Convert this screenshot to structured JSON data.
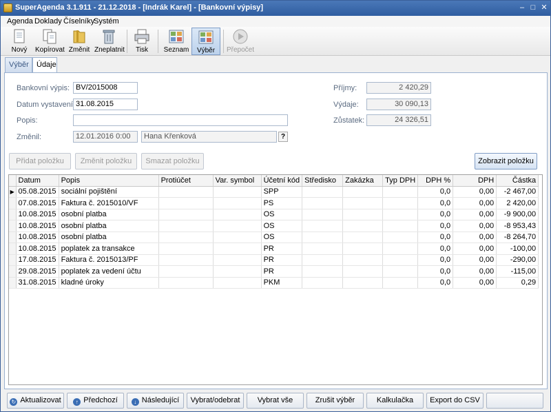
{
  "window": {
    "title": "SuperAgenda 3.1.911 - 21.12.2018 - [Indrák Karel] - [Bankovní výpisy]"
  },
  "menu": [
    "Agenda",
    "Doklady",
    "Číselníky",
    "Systém"
  ],
  "toolbar": {
    "new": "Nový",
    "copy": "Kopírovat",
    "edit": "Změnit",
    "invalidate": "Zneplatnit",
    "print": "Tisk",
    "list": "Seznam",
    "select": "Výběr",
    "recalc": "Přepočet"
  },
  "tabs": [
    "Výběr",
    "Údaje"
  ],
  "form": {
    "statement_label": "Bankovní výpis:",
    "statement_value": "BV/2015008",
    "date_label": "Datum vystavení:",
    "date_value": "31.08.2015",
    "desc_label": "Popis:",
    "desc_value": "",
    "changed_label": "Změnil:",
    "changed_date": "12.01.2016 0:00",
    "changed_user": "Hana Křenková",
    "help_label": "?",
    "income_label": "Příjmy:",
    "income_value": "2 420,29",
    "expense_label": "Výdaje:",
    "expense_value": "30 090,13",
    "balance_label": "Zůstatek:",
    "balance_value": "24 326,51"
  },
  "actions": {
    "add_item": "Přidat položku",
    "edit_item": "Změnit položku",
    "delete_item": "Smazat položku",
    "show_item": "Zobrazit položku"
  },
  "grid": {
    "columns": [
      "Datum",
      "Popis",
      "Protiúčet",
      "Var. symbol",
      "Účetní kód",
      "Středisko",
      "Zakázka",
      "Typ DPH",
      "DPH %",
      "DPH",
      "Částka"
    ],
    "rows": [
      [
        "05.08.2015",
        "sociální pojištění",
        "",
        "",
        "SPP",
        "",
        "",
        "",
        "0,0",
        "0,00",
        "-2 467,00"
      ],
      [
        "07.08.2015",
        "Faktura č. 2015010/VF",
        "",
        "",
        "PS",
        "",
        "",
        "",
        "0,0",
        "0,00",
        "2 420,00"
      ],
      [
        "10.08.2015",
        "osobní platba",
        "",
        "",
        "OS",
        "",
        "",
        "",
        "0,0",
        "0,00",
        "-9 900,00"
      ],
      [
        "10.08.2015",
        "osobní platba",
        "",
        "",
        "OS",
        "",
        "",
        "",
        "0,0",
        "0,00",
        "-8 953,43"
      ],
      [
        "10.08.2015",
        "osobní platba",
        "",
        "",
        "OS",
        "",
        "",
        "",
        "0,0",
        "0,00",
        "-8 264,70"
      ],
      [
        "10.08.2015",
        "poplatek za transakce",
        "",
        "",
        "PR",
        "",
        "",
        "",
        "0,0",
        "0,00",
        "-100,00"
      ],
      [
        "17.08.2015",
        "Faktura č. 2015013/PF",
        "",
        "",
        "PR",
        "",
        "",
        "",
        "0,0",
        "0,00",
        "-290,00"
      ],
      [
        "29.08.2015",
        "poplatek za vedení účtu",
        "",
        "",
        "PR",
        "",
        "",
        "",
        "0,0",
        "0,00",
        "-115,00"
      ],
      [
        "31.08.2015",
        "kladné úroky",
        "",
        "",
        "PKM",
        "",
        "",
        "",
        "0,0",
        "0,00",
        "0,29"
      ]
    ]
  },
  "bottom": {
    "refresh": "Aktualizovat",
    "prev": "Předchozí",
    "next": "Následující",
    "toggle_select": "Vybrat/odebrat",
    "select_all": "Vybrat vše",
    "cancel_select": "Zrušit výběr",
    "calculator": "Kalkulačka",
    "export_csv": "Export do CSV"
  }
}
